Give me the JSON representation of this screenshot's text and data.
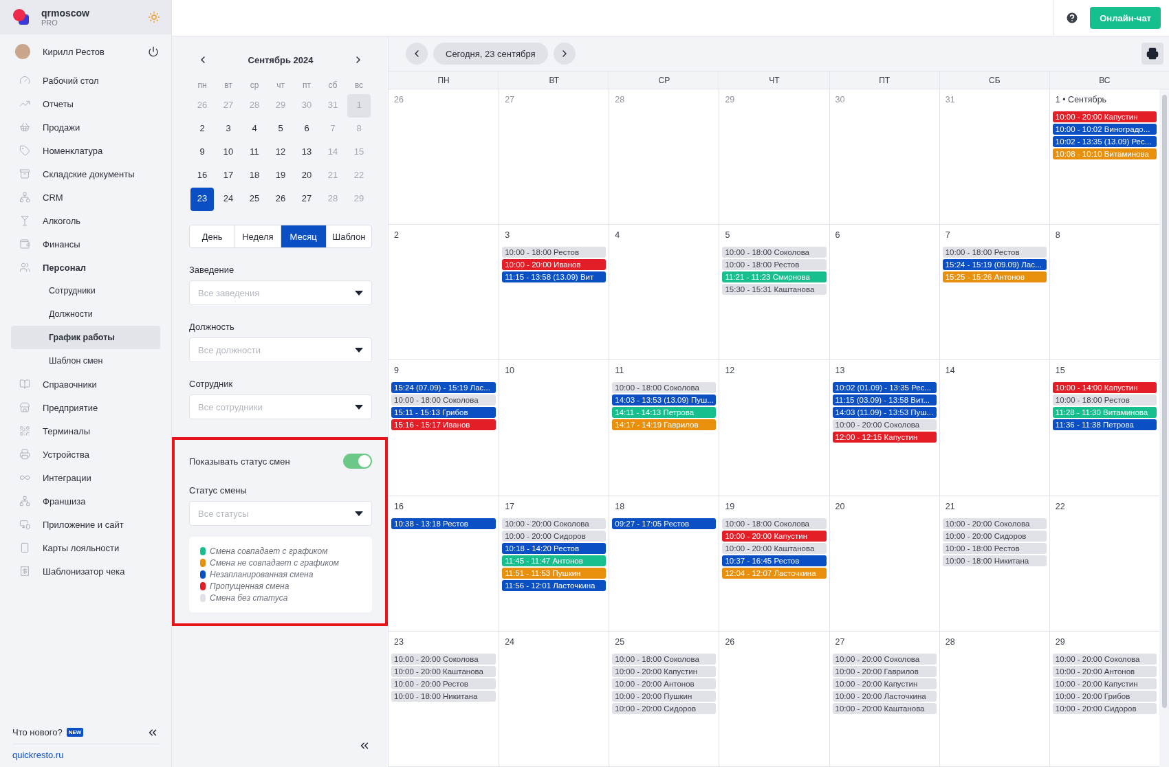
{
  "brand": {
    "name": "qrmoscow",
    "plan": "PRO"
  },
  "user": {
    "name": "Кирилл Рестов"
  },
  "nav": [
    {
      "label": "Рабочий стол",
      "expanded": false
    },
    {
      "label": "Отчеты",
      "expanded": false
    },
    {
      "label": "Продажи",
      "expanded": false
    },
    {
      "label": "Номенклатура",
      "expanded": false
    },
    {
      "label": "Складские документы",
      "expanded": false
    },
    {
      "label": "CRM",
      "expanded": false
    },
    {
      "label": "Алкоголь",
      "expanded": false
    },
    {
      "label": "Финансы",
      "expanded": false
    },
    {
      "label": "Персонал",
      "expanded": true,
      "children": [
        {
          "label": "Сотрудники",
          "selected": false
        },
        {
          "label": "Должности",
          "selected": false
        },
        {
          "label": "График работы",
          "selected": true
        },
        {
          "label": "Шаблон смен",
          "selected": false
        }
      ]
    },
    {
      "label": "Справочники",
      "expanded": false
    },
    {
      "label": "Предприятие",
      "expanded": false
    },
    {
      "label": "Терминалы",
      "expanded": false
    },
    {
      "label": "Устройства",
      "expanded": false
    },
    {
      "label": "Интеграции",
      "expanded": false
    },
    {
      "label": "Франшиза",
      "expanded": false
    },
    {
      "label": "Приложение и сайт",
      "expanded": false
    },
    {
      "label": "Карты лояльности",
      "expanded": false
    },
    {
      "label": "Шаблонизатор чека",
      "expanded": false
    }
  ],
  "whats_new": {
    "label": "Что нового?",
    "badge": "NEW"
  },
  "site_link": "quickresto.ru",
  "header": {
    "chat_button": "Онлайн-чат"
  },
  "mini_calendar": {
    "title": "Сентябрь 2024",
    "weekdays": [
      "пн",
      "вт",
      "ср",
      "чт",
      "пт",
      "сб",
      "вс"
    ],
    "days": [
      {
        "label": "26",
        "muted": true,
        "selected": false,
        "highlighted": false
      },
      {
        "label": "27",
        "muted": true,
        "selected": false,
        "highlighted": false
      },
      {
        "label": "28",
        "muted": true,
        "selected": false,
        "highlighted": false
      },
      {
        "label": "29",
        "muted": true,
        "selected": false,
        "highlighted": false
      },
      {
        "label": "30",
        "muted": true,
        "selected": false,
        "highlighted": false
      },
      {
        "label": "31",
        "muted": true,
        "selected": false,
        "highlighted": false
      },
      {
        "label": "1",
        "muted": true,
        "selected": false,
        "highlighted": true
      },
      {
        "label": "2",
        "muted": false,
        "selected": false,
        "highlighted": false
      },
      {
        "label": "3",
        "muted": false,
        "selected": false,
        "highlighted": false
      },
      {
        "label": "4",
        "muted": false,
        "selected": false,
        "highlighted": false
      },
      {
        "label": "5",
        "muted": false,
        "selected": false,
        "highlighted": false
      },
      {
        "label": "6",
        "muted": false,
        "selected": false,
        "highlighted": false
      },
      {
        "label": "7",
        "muted": true,
        "selected": false,
        "highlighted": false
      },
      {
        "label": "8",
        "muted": true,
        "selected": false,
        "highlighted": false
      },
      {
        "label": "9",
        "muted": false,
        "selected": false,
        "highlighted": false
      },
      {
        "label": "10",
        "muted": false,
        "selected": false,
        "highlighted": false
      },
      {
        "label": "11",
        "muted": false,
        "selected": false,
        "highlighted": false
      },
      {
        "label": "12",
        "muted": false,
        "selected": false,
        "highlighted": false
      },
      {
        "label": "13",
        "muted": false,
        "selected": false,
        "highlighted": false
      },
      {
        "label": "14",
        "muted": true,
        "selected": false,
        "highlighted": false
      },
      {
        "label": "15",
        "muted": true,
        "selected": false,
        "highlighted": false
      },
      {
        "label": "16",
        "muted": false,
        "selected": false,
        "highlighted": false
      },
      {
        "label": "17",
        "muted": false,
        "selected": false,
        "highlighted": false
      },
      {
        "label": "18",
        "muted": false,
        "selected": false,
        "highlighted": false
      },
      {
        "label": "19",
        "muted": false,
        "selected": false,
        "highlighted": false
      },
      {
        "label": "20",
        "muted": false,
        "selected": false,
        "highlighted": false
      },
      {
        "label": "21",
        "muted": true,
        "selected": false,
        "highlighted": false
      },
      {
        "label": "22",
        "muted": true,
        "selected": false,
        "highlighted": false
      },
      {
        "label": "23",
        "muted": false,
        "selected": true,
        "highlighted": false
      },
      {
        "label": "24",
        "muted": false,
        "selected": false,
        "highlighted": false
      },
      {
        "label": "25",
        "muted": false,
        "selected": false,
        "highlighted": false
      },
      {
        "label": "26",
        "muted": false,
        "selected": false,
        "highlighted": false
      },
      {
        "label": "27",
        "muted": false,
        "selected": false,
        "highlighted": false
      },
      {
        "label": "28",
        "muted": true,
        "selected": false,
        "highlighted": false
      },
      {
        "label": "29",
        "muted": true,
        "selected": false,
        "highlighted": false
      }
    ]
  },
  "view_modes": [
    {
      "label": "День",
      "selected": false
    },
    {
      "label": "Неделя",
      "selected": false
    },
    {
      "label": "Месяц",
      "selected": true
    },
    {
      "label": "Шаблон",
      "selected": false
    }
  ],
  "filters": [
    {
      "label": "Заведение",
      "placeholder": "Все заведения"
    },
    {
      "label": "Должность",
      "placeholder": "Все должности"
    },
    {
      "label": "Сотрудник",
      "placeholder": "Все сотрудники"
    }
  ],
  "status_section": {
    "toggle_label": "Показывать статус смен",
    "on": true,
    "filter_label": "Статус смены",
    "filter_placeholder": "Все статусы",
    "legend": [
      {
        "label": "Смена совпадает с графиком",
        "color": "#17bf8e"
      },
      {
        "label": "Смена не совпадает с графиком",
        "color": "#e8900c"
      },
      {
        "label": "Незапланированная смена",
        "color": "#0b4fc4"
      },
      {
        "label": "Пропущенная смена",
        "color": "#e31e26"
      },
      {
        "label": "Смена без статуса",
        "color": "#e1e2e7"
      }
    ]
  },
  "calendar": {
    "today_button": "Сегодня, 23 сентября",
    "weekdays": [
      "ПН",
      "ВТ",
      "СР",
      "ЧТ",
      "ПТ",
      "СБ",
      "ВС"
    ],
    "cells": [
      {
        "day": "26",
        "muted": true
      },
      {
        "day": "27",
        "muted": true
      },
      {
        "day": "28",
        "muted": true
      },
      {
        "day": "29",
        "muted": true
      },
      {
        "day": "30",
        "muted": true
      },
      {
        "day": "31",
        "muted": true
      },
      {
        "day": "1 • Сентябрь",
        "muted": false,
        "events": [
          {
            "text": "10:00 - 20:00 Капустин",
            "color": "#e31e26"
          },
          {
            "text": "10:00 - 10:02 Виноградо...",
            "color": "#0b4fc4"
          },
          {
            "text": "10:02 - 13:35 (13.09) Рес...",
            "color": "#0b4fc4"
          },
          {
            "text": "10:08 - 10:10 Витаминова",
            "color": "#e8900c"
          }
        ]
      },
      {
        "day": "2",
        "muted": false
      },
      {
        "day": "3",
        "muted": false,
        "events": [
          {
            "text": "10:00 - 18:00 Рестов",
            "color": "#e1e2e7"
          },
          {
            "text": "10:00 - 20:00 Иванов",
            "color": "#e31e26"
          },
          {
            "text": "11:15 - 13:58 (13.09) Вит",
            "color": "#0b4fc4"
          }
        ]
      },
      {
        "day": "4",
        "muted": false
      },
      {
        "day": "5",
        "muted": false,
        "events": [
          {
            "text": "10:00 - 18:00 Соколова",
            "color": "#e1e2e7"
          },
          {
            "text": "10:00 - 18:00 Рестов",
            "color": "#e1e2e7"
          },
          {
            "text": "11:21 - 11:23 Смирнова",
            "color": "#17bf8e"
          },
          {
            "text": "15:30 - 15:31 Каштанова",
            "color": "#e1e2e7"
          }
        ]
      },
      {
        "day": "6",
        "muted": false
      },
      {
        "day": "7",
        "muted": false,
        "events": [
          {
            "text": "10:00 - 18:00 Рестов",
            "color": "#e1e2e7"
          },
          {
            "text": "15:24 - 15:19 (09.09) Лас...",
            "color": "#0b4fc4"
          },
          {
            "text": "15:25 - 15:26 Антонов",
            "color": "#e8900c"
          }
        ]
      },
      {
        "day": "8",
        "muted": false
      },
      {
        "day": "9",
        "muted": false,
        "events": [
          {
            "text": "15:24 (07.09) - 15:19 Лас...",
            "color": "#0b4fc4"
          },
          {
            "text": "10:00 - 18:00 Соколова",
            "color": "#e1e2e7"
          },
          {
            "text": "15:11 - 15:13 Грибов",
            "color": "#0b4fc4"
          },
          {
            "text": "15:16 - 15:17 Иванов",
            "color": "#e31e26"
          }
        ]
      },
      {
        "day": "10",
        "muted": false
      },
      {
        "day": "11",
        "muted": false,
        "events": [
          {
            "text": "10:00 - 18:00 Соколова",
            "color": "#e1e2e7"
          },
          {
            "text": "14:03 - 13:53 (13.09) Пуш...",
            "color": "#0b4fc4"
          },
          {
            "text": "14:11 - 14:13 Петрова",
            "color": "#17bf8e"
          },
          {
            "text": "14:17 - 14:19 Гаврилов",
            "color": "#e8900c"
          }
        ]
      },
      {
        "day": "12",
        "muted": false
      },
      {
        "day": "13",
        "muted": false,
        "events": [
          {
            "text": "10:02 (01.09) - 13:35 Рес...",
            "color": "#0b4fc4"
          },
          {
            "text": "11:15 (03.09) - 13:58 Вит...",
            "color": "#0b4fc4"
          },
          {
            "text": "14:03 (11.09) - 13:53 Пуш...",
            "color": "#0b4fc4"
          },
          {
            "text": "10:00 - 20:00 Соколова",
            "color": "#e1e2e7"
          },
          {
            "text": "12:00 - 12:15 Капустин",
            "color": "#e31e26"
          }
        ]
      },
      {
        "day": "14",
        "muted": false
      },
      {
        "day": "15",
        "muted": false,
        "events": [
          {
            "text": "10:00 - 14:00 Капустин",
            "color": "#e31e26"
          },
          {
            "text": "10:00 - 18:00 Рестов",
            "color": "#e1e2e7"
          },
          {
            "text": "11:28 - 11:30 Витаминова",
            "color": "#17bf8e"
          },
          {
            "text": "11:36 - 11:38 Петрова",
            "color": "#0b4fc4"
          }
        ]
      },
      {
        "day": "16",
        "muted": false,
        "events": [
          {
            "text": "10:38 - 13:18 Рестов",
            "color": "#0b4fc4"
          }
        ]
      },
      {
        "day": "17",
        "muted": false,
        "events": [
          {
            "text": "10:00 - 20:00 Соколова",
            "color": "#e1e2e7"
          },
          {
            "text": "10:00 - 20:00 Сидоров",
            "color": "#e1e2e7"
          },
          {
            "text": "10:18 - 14:20 Рестов",
            "color": "#0b4fc4"
          },
          {
            "text": "11:45 - 11:47 Антонов",
            "color": "#17bf8e"
          },
          {
            "text": "11:51 - 11:53 Пушкин",
            "color": "#e8900c"
          },
          {
            "text": "11:56 - 12:01 Ласточкина",
            "color": "#0b4fc4"
          }
        ]
      },
      {
        "day": "18",
        "muted": false,
        "events": [
          {
            "text": "09:27 - 17:05 Рестов",
            "color": "#0b4fc4"
          }
        ]
      },
      {
        "day": "19",
        "muted": false,
        "events": [
          {
            "text": "10:00 - 18:00 Соколова",
            "color": "#e1e2e7"
          },
          {
            "text": "10:00 - 20:00 Капустин",
            "color": "#e31e26"
          },
          {
            "text": "10:00 - 20:00 Каштанова",
            "color": "#e1e2e7"
          },
          {
            "text": "10:37 - 16:45 Рестов",
            "color": "#0b4fc4"
          },
          {
            "text": "12:04 - 12:07 Ласточкина",
            "color": "#e8900c"
          }
        ]
      },
      {
        "day": "20",
        "muted": false
      },
      {
        "day": "21",
        "muted": false,
        "events": [
          {
            "text": "10:00 - 20:00 Соколова",
            "color": "#e1e2e7"
          },
          {
            "text": "10:00 - 20:00 Сидоров",
            "color": "#e1e2e7"
          },
          {
            "text": "10:00 - 18:00 Рестов",
            "color": "#e1e2e7"
          },
          {
            "text": "10:00 - 18:00 Никитана",
            "color": "#e1e2e7"
          }
        ]
      },
      {
        "day": "22",
        "muted": false
      },
      {
        "day": "23",
        "muted": false,
        "events": [
          {
            "text": "10:00 - 20:00 Соколова",
            "color": "#e1e2e7"
          },
          {
            "text": "10:00 - 20:00 Каштанова",
            "color": "#e1e2e7"
          },
          {
            "text": "10:00 - 20:00 Рестов",
            "color": "#e1e2e7"
          },
          {
            "text": "10:00 - 18:00 Никитана",
            "color": "#e1e2e7"
          }
        ]
      },
      {
        "day": "24",
        "muted": false
      },
      {
        "day": "25",
        "muted": false,
        "events": [
          {
            "text": "10:00 - 18:00 Соколова",
            "color": "#e1e2e7"
          },
          {
            "text": "10:00 - 20:00 Капустин",
            "color": "#e1e2e7"
          },
          {
            "text": "10:00 - 20:00 Антонов",
            "color": "#e1e2e7"
          },
          {
            "text": "10:00 - 20:00 Пушкин",
            "color": "#e1e2e7"
          },
          {
            "text": "10:00 - 20:00 Сидоров",
            "color": "#e1e2e7"
          }
        ]
      },
      {
        "day": "26",
        "muted": false
      },
      {
        "day": "27",
        "muted": false,
        "events": [
          {
            "text": "10:00 - 20:00 Соколова",
            "color": "#e1e2e7"
          },
          {
            "text": "10:00 - 20:00 Гаврилов",
            "color": "#e1e2e7"
          },
          {
            "text": "10:00 - 20:00 Капустин",
            "color": "#e1e2e7"
          },
          {
            "text": "10:00 - 20:00 Ласточкина",
            "color": "#e1e2e7"
          },
          {
            "text": "10:00 - 20:00 Каштанова",
            "color": "#e1e2e7"
          }
        ]
      },
      {
        "day": "28",
        "muted": false
      },
      {
        "day": "29",
        "muted": false,
        "events": [
          {
            "text": "10:00 - 20:00 Соколова",
            "color": "#e1e2e7"
          },
          {
            "text": "10:00 - 20:00 Антонов",
            "color": "#e1e2e7"
          },
          {
            "text": "10:00 - 20:00 Капустин",
            "color": "#e1e2e7"
          },
          {
            "text": "10:00 - 20:00 Грибов",
            "color": "#e1e2e7"
          },
          {
            "text": "10:00 - 20:00 Сидоров",
            "color": "#e1e2e7"
          }
        ]
      }
    ]
  }
}
